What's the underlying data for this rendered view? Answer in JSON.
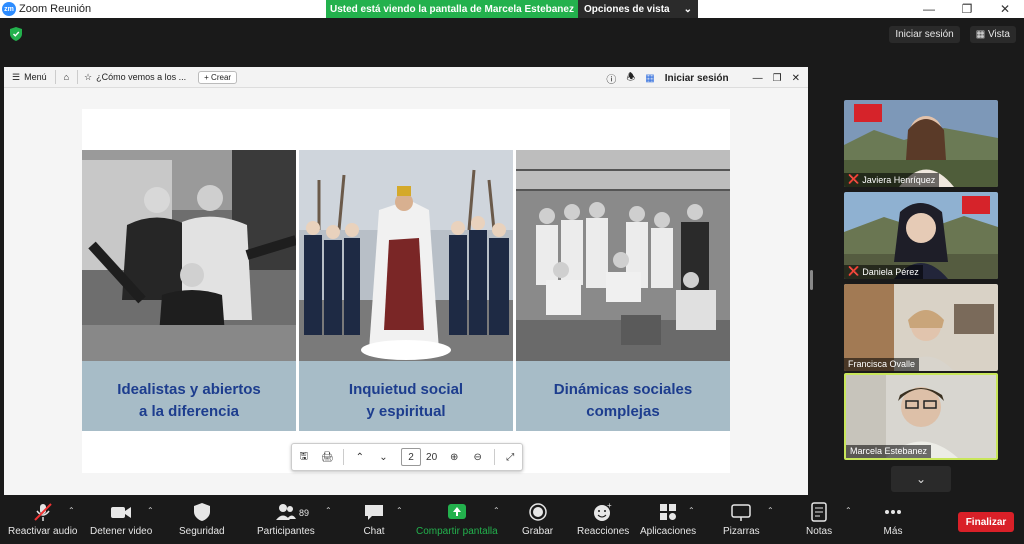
{
  "app": {
    "title": "Zoom Reunión",
    "logo_text": "zm"
  },
  "share_banner": {
    "message": "Usted está viendo la pantalla de Marcela Estebanez",
    "view_options": "Opciones de vista"
  },
  "top_right": {
    "login": "Iniciar sesión",
    "view": "Vista"
  },
  "shared_app": {
    "menu": "Menú",
    "tab_title": "¿Cómo vemos a los ...",
    "new_button": "Crear",
    "login": "Iniciar sesión"
  },
  "document": {
    "panels": [
      {
        "caption_line1": "Idealistas y abiertos",
        "caption_line2": "a la diferencia"
      },
      {
        "caption_line1": "Inquietud social",
        "caption_line2": "y espiritual"
      },
      {
        "caption_line1": "Dinámicas sociales",
        "caption_line2": "complejas"
      }
    ],
    "caption_color": "#1d3d8e",
    "panel_bg": "#a7bcc7"
  },
  "pdf_toolbar": {
    "current_page": "2",
    "total_pages": "20"
  },
  "participants_videos": [
    {
      "name": "Javiera Henríquez",
      "muted": true
    },
    {
      "name": "Daniela Pérez",
      "muted": true
    },
    {
      "name": "Francisca Ovalle",
      "muted": false
    },
    {
      "name": "Marcela Estebanez",
      "muted": false,
      "active_speaker": true
    }
  ],
  "controls": {
    "audio": "Reactivar audio",
    "video": "Detener video",
    "security": "Seguridad",
    "participants": "Participantes",
    "participants_count": "89",
    "chat": "Chat",
    "share": "Compartir pantalla",
    "record": "Grabar",
    "reactions": "Reacciones",
    "apps": "Aplicaciones",
    "whiteboards": "Pizarras",
    "notes": "Notas",
    "more": "Más",
    "end": "Finalizar"
  },
  "colors": {
    "share_green": "#23b14d",
    "end_red": "#d92028",
    "active_speaker_border": "#c8e65a"
  }
}
